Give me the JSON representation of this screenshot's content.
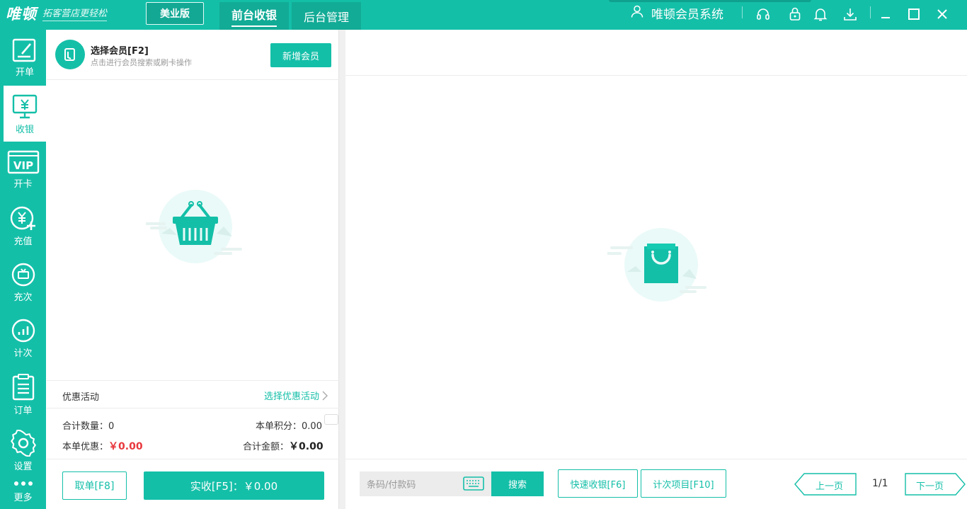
{
  "app": {
    "logo_main": "唯顿",
    "logo_slogan": "拓客营店更轻松",
    "edition": "美业版",
    "system_name": "唯顿会员系统",
    "accent_color": "#14bfa8"
  },
  "nav": {
    "tabs": [
      {
        "label": "前台收银",
        "active": true
      },
      {
        "label": "后台管理",
        "active": false
      }
    ]
  },
  "window_icons": [
    "user-icon",
    "headset-icon",
    "lock-icon",
    "bell-icon",
    "download-icon",
    "minimize-icon",
    "maximize-icon",
    "close-icon"
  ],
  "sidebar": {
    "items": [
      {
        "label": "开单",
        "icon": "edit-icon"
      },
      {
        "label": "收银",
        "icon": "cashier-icon",
        "active": true
      },
      {
        "label": "开卡",
        "icon": "vip-icon"
      },
      {
        "label": "充值",
        "icon": "recharge-icon"
      },
      {
        "label": "充次",
        "icon": "recharge-count-icon"
      },
      {
        "label": "计次",
        "icon": "count-chart-icon"
      },
      {
        "label": "订单",
        "icon": "order-icon"
      },
      {
        "label": "设置",
        "icon": "settings-icon"
      },
      {
        "label": "更多",
        "icon": "more-icon"
      }
    ]
  },
  "member": {
    "title": "选择会员[F2]",
    "subtitle": "点击进行会员搜索或刷卡操作",
    "new_member_label": "新增会员"
  },
  "promo": {
    "label": "优惠活动",
    "link": "选择优惠活动"
  },
  "summary": {
    "qty_label": "合计数量：",
    "qty_value": "0",
    "points_label": "本单积分：",
    "points_value": "0.00",
    "discount_label": "本单优惠：",
    "discount_value": "￥0.00",
    "total_label": "合计金额：",
    "total_value": "￥0.00"
  },
  "actions": {
    "cancel_label": "取单[F8]",
    "pay_label": "实收[F5]：￥0.00"
  },
  "product_search": {
    "placeholder": "条码/付款码",
    "search_label": "搜索",
    "quick_cashier_label": "快速收银[F6]",
    "count_items_label": "计次项目[F10]",
    "prev_label": "上一页",
    "page_indicator": "1/1",
    "next_label": "下一页"
  }
}
